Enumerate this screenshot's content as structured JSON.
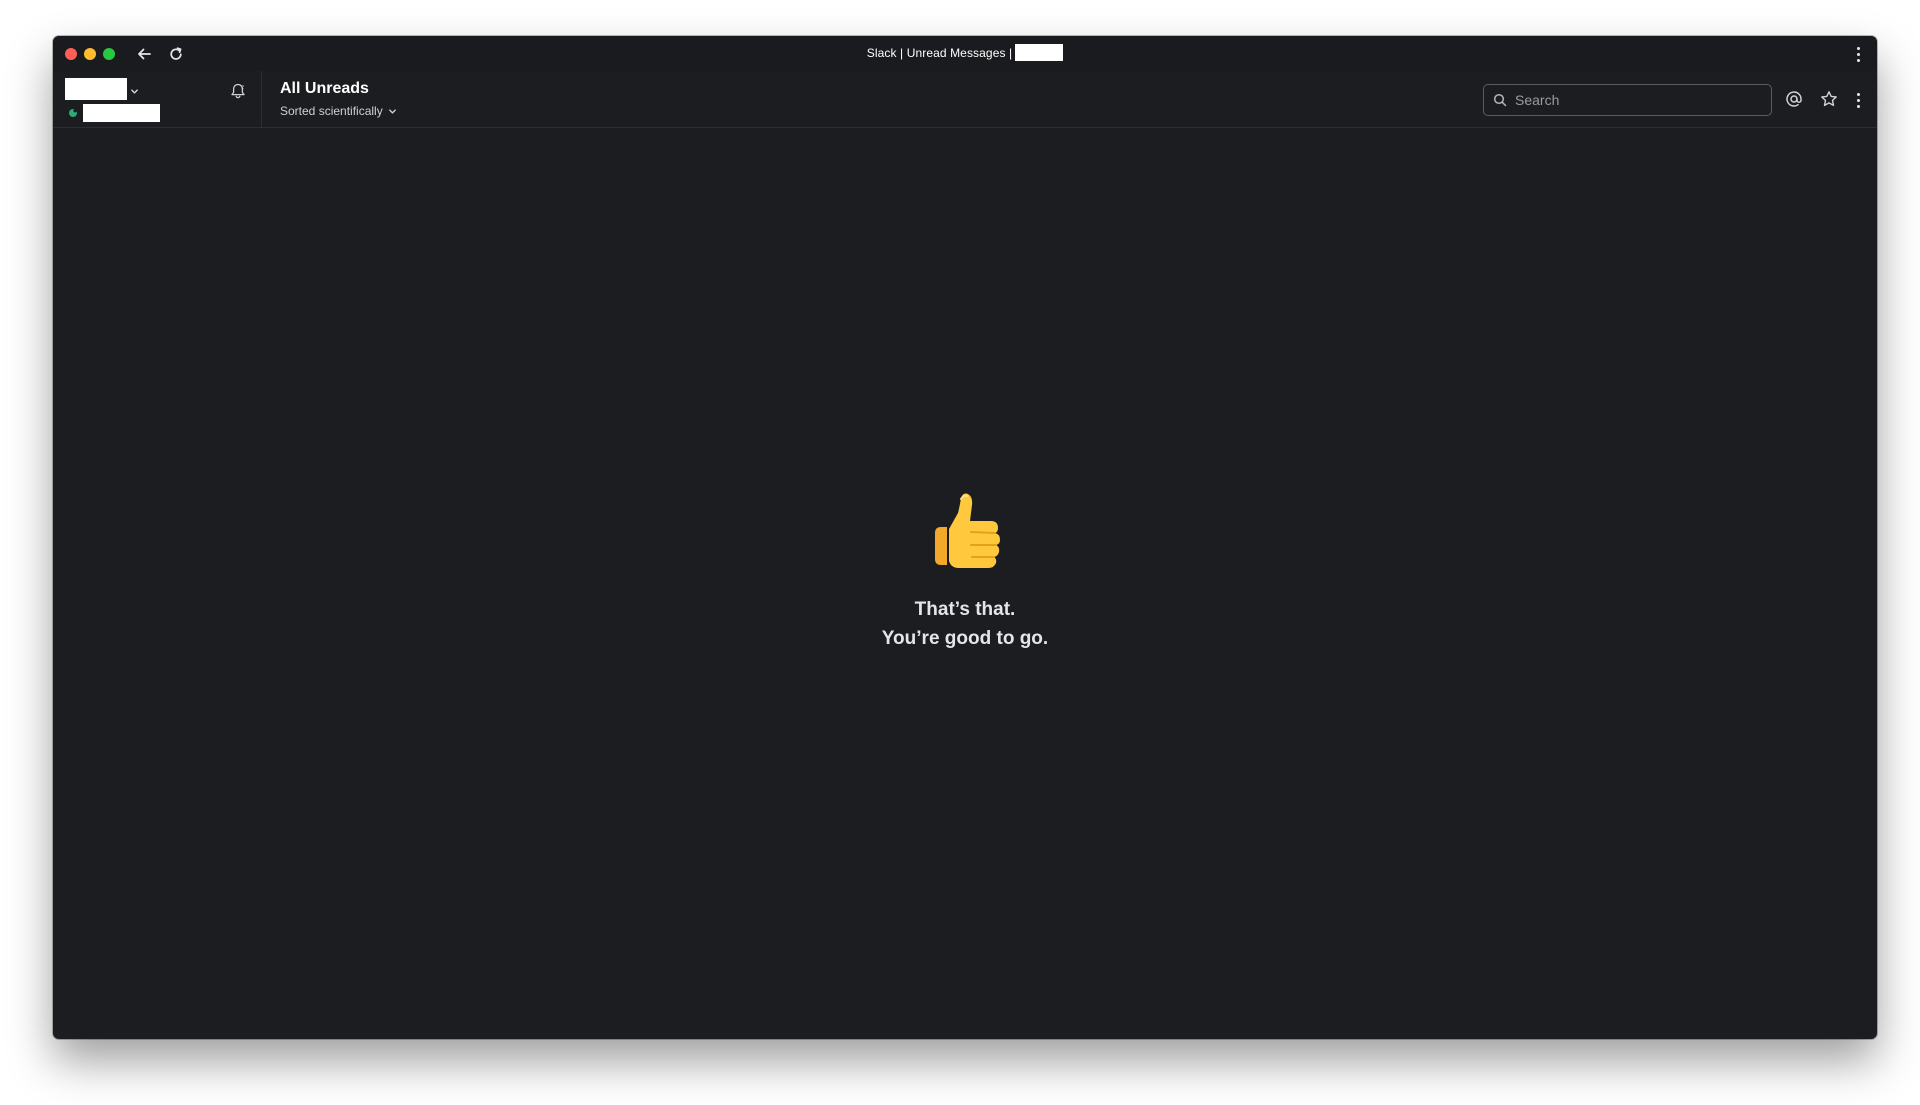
{
  "window": {
    "title": "Slack | Unread Messages |"
  },
  "header": {
    "view_title": "All Unreads",
    "sort_label": "Sorted scientifically",
    "search_placeholder": "Search"
  },
  "empty_state": {
    "emoji": "thumbs-up",
    "line1": "That’s that.",
    "line2": "You’re good to go."
  },
  "icons": {
    "back": "arrow-left-icon",
    "reload": "reload-icon",
    "bell": "bell-icon",
    "search": "search-icon",
    "mention": "at-icon",
    "star": "star-icon",
    "more": "more-vertical-icon"
  },
  "colors": {
    "background": "#1b1d21",
    "titlebar": "#1a1b1e",
    "presence": "#2bac76",
    "text": "#ffffff"
  }
}
